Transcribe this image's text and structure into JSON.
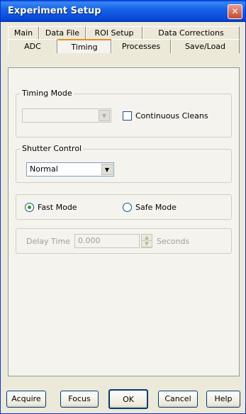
{
  "window": {
    "title": "Experiment Setup"
  },
  "tabs": {
    "row1": [
      "Main",
      "Data File",
      "ROI Setup",
      "Data Corrections"
    ],
    "row2": [
      "ADC",
      "Timing",
      "Processes",
      "Save/Load"
    ],
    "active": "Timing"
  },
  "timing_mode": {
    "group_label": "Timing Mode",
    "combo_value": "",
    "continuous_cleans_label": "Continuous Cleans",
    "continuous_cleans_checked": false
  },
  "shutter_control": {
    "group_label": "Shutter Control",
    "combo_value": "Normal"
  },
  "mode": {
    "fast_label": "Fast Mode",
    "safe_label": "Safe Mode",
    "selected": "Fast Mode"
  },
  "delay": {
    "label": "Delay Time",
    "value": "0.000",
    "unit": "Seconds"
  },
  "buttons": {
    "acquire": "Acquire",
    "focus": "Focus",
    "ok": "OK",
    "cancel": "Cancel",
    "help": "Help"
  }
}
